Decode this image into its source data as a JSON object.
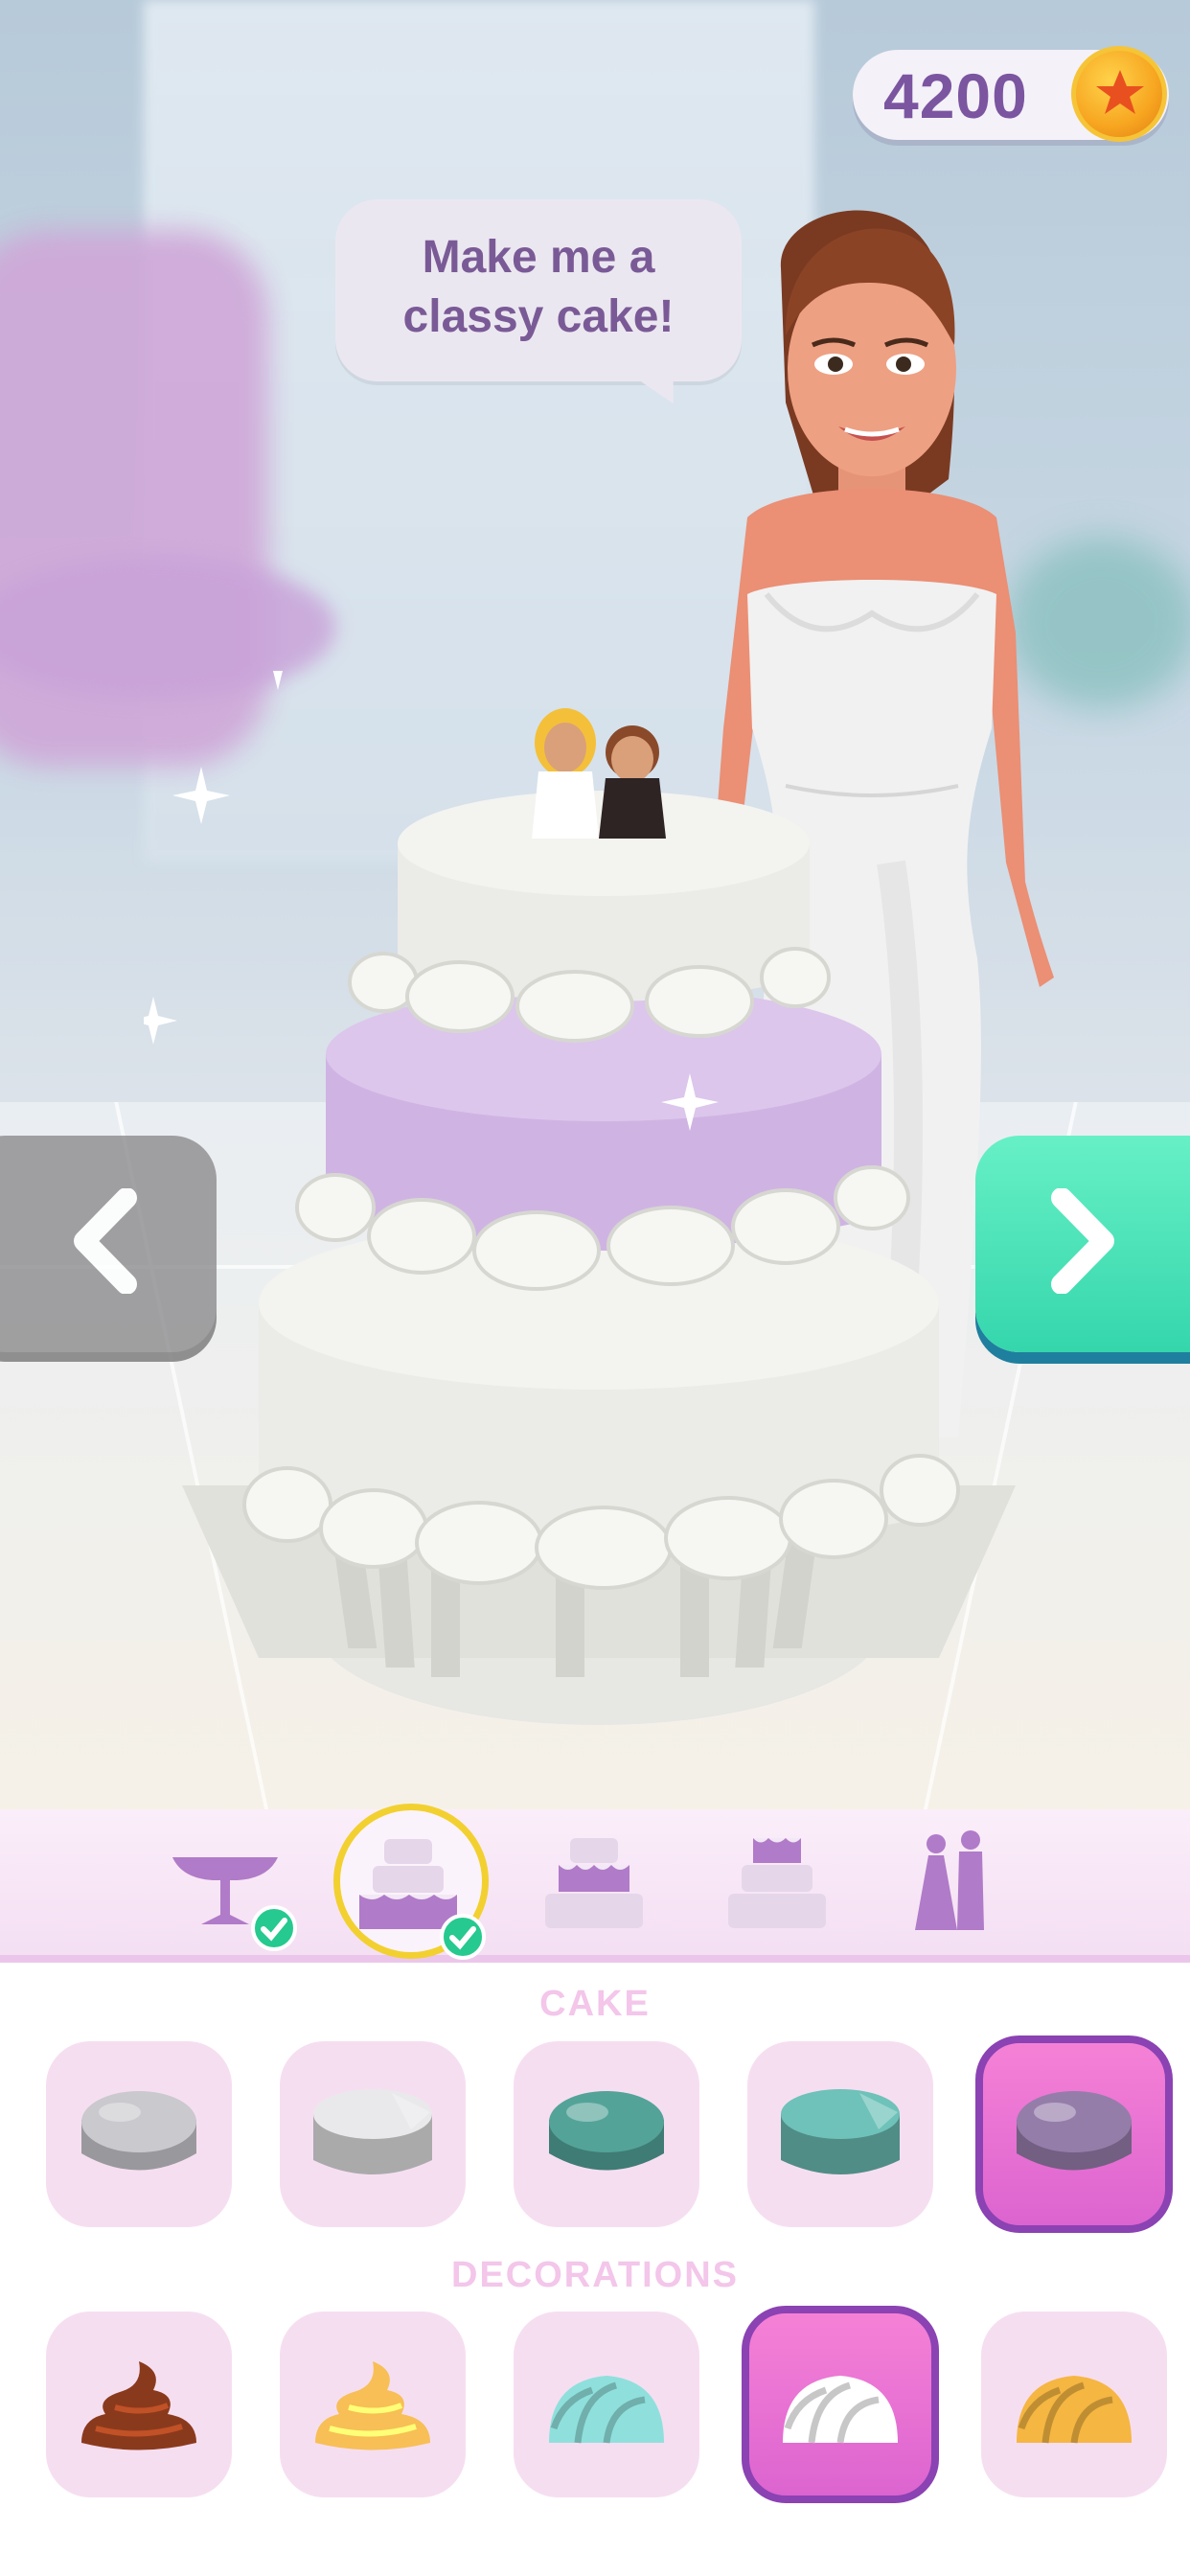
{
  "hud": {
    "coins": "4200",
    "coin_icon": "star-coin-icon"
  },
  "speech": {
    "line1": "Make me a",
    "line2": "classy cake!"
  },
  "steps": [
    {
      "name": "stand",
      "done": true
    },
    {
      "name": "cake",
      "done": true,
      "active": true
    },
    {
      "name": "middle-layer",
      "done": false
    },
    {
      "name": "top-layer",
      "done": false
    },
    {
      "name": "topper",
      "done": false
    }
  ],
  "sections": {
    "cake_label": "CAKE",
    "decorations_label": "DECORATIONS"
  },
  "cake_options": [
    {
      "color": "#bfbfc4",
      "shape": "round",
      "selected": false
    },
    {
      "color": "#d4d4d6",
      "shape": "flat",
      "selected": false
    },
    {
      "color": "#4f9b92",
      "shape": "round",
      "selected": false
    },
    {
      "color": "#64b0a8",
      "shape": "flat",
      "selected": false
    },
    {
      "color": "#8e77a2",
      "shape": "round",
      "selected": true
    }
  ],
  "decoration_options": [
    {
      "color": "#8a3a1c",
      "shape": "swirl",
      "selected": false
    },
    {
      "color": "#f7bf55",
      "shape": "swirl",
      "selected": false
    },
    {
      "color": "#8fe0dc",
      "shape": "shell",
      "selected": false
    },
    {
      "color": "#ffffff",
      "shape": "shell",
      "selected": true
    },
    {
      "color": "#f5b642",
      "shape": "shell",
      "selected": false
    }
  ]
}
